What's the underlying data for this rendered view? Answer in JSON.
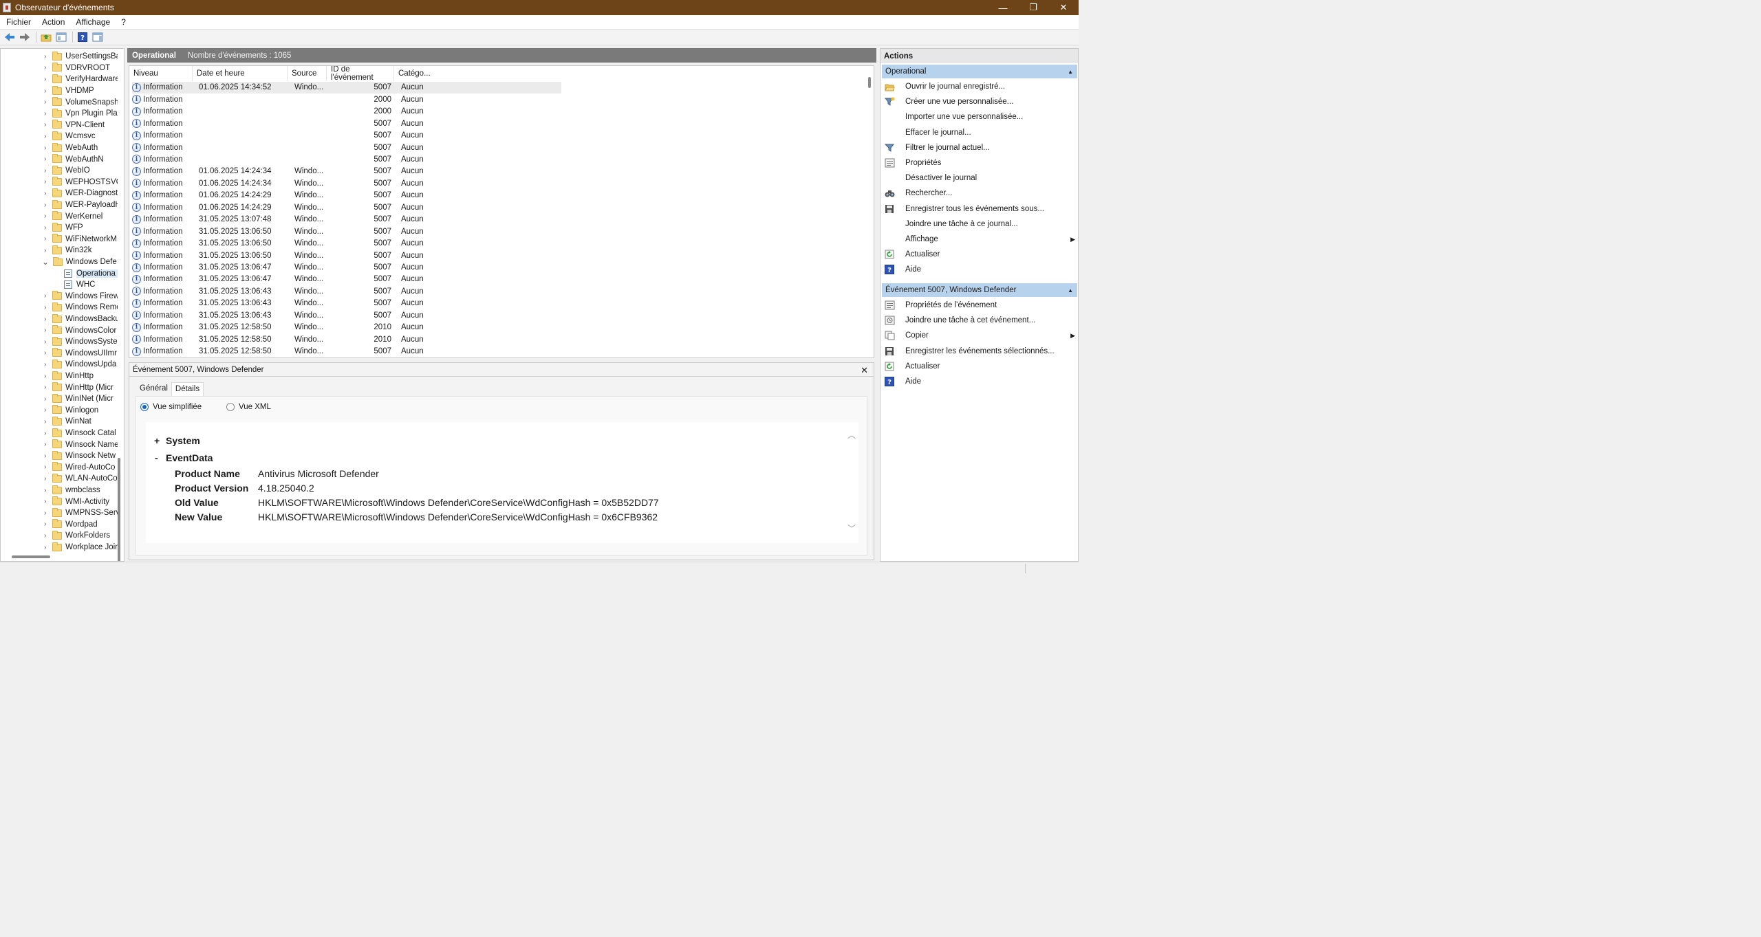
{
  "window": {
    "title": "Observateur d'événements",
    "minimize": "—",
    "maximize": "❐",
    "close": "✕"
  },
  "menu": [
    "Fichier",
    "Action",
    "Affichage",
    "?"
  ],
  "tree": {
    "items": [
      {
        "label": "UserSettingsBa",
        "type": "folder",
        "expanded": false
      },
      {
        "label": "VDRVROOT",
        "type": "folder",
        "expanded": false
      },
      {
        "label": "VerifyHardware",
        "type": "folder",
        "expanded": false
      },
      {
        "label": "VHDMP",
        "type": "folder",
        "expanded": false
      },
      {
        "label": "VolumeSnapsh",
        "type": "folder",
        "expanded": false
      },
      {
        "label": "Vpn Plugin Pla",
        "type": "folder",
        "expanded": false
      },
      {
        "label": "VPN-Client",
        "type": "folder",
        "expanded": false
      },
      {
        "label": "Wcmsvc",
        "type": "folder",
        "expanded": false
      },
      {
        "label": "WebAuth",
        "type": "folder",
        "expanded": false
      },
      {
        "label": "WebAuthN",
        "type": "folder",
        "expanded": false
      },
      {
        "label": "WebIO",
        "type": "folder",
        "expanded": false
      },
      {
        "label": "WEPHOSTSVC",
        "type": "folder",
        "expanded": false
      },
      {
        "label": "WER-Diagnost",
        "type": "folder",
        "expanded": false
      },
      {
        "label": "WER-PayloadH",
        "type": "folder",
        "expanded": false
      },
      {
        "label": "WerKernel",
        "type": "folder",
        "expanded": false
      },
      {
        "label": "WFP",
        "type": "folder",
        "expanded": false
      },
      {
        "label": "WiFiNetworkM",
        "type": "folder",
        "expanded": false
      },
      {
        "label": "Win32k",
        "type": "folder",
        "expanded": false
      },
      {
        "label": "Windows Defe",
        "type": "folder",
        "expanded": true
      },
      {
        "label": "Operationa",
        "type": "log",
        "selected": true
      },
      {
        "label": "WHC",
        "type": "log"
      },
      {
        "label": "Windows Firew",
        "type": "folder",
        "expanded": false
      },
      {
        "label": "Windows Remo",
        "type": "folder",
        "expanded": false
      },
      {
        "label": "WindowsBacku",
        "type": "folder",
        "expanded": false
      },
      {
        "label": "WindowsColor",
        "type": "folder",
        "expanded": false
      },
      {
        "label": "WindowsSyste",
        "type": "folder",
        "expanded": false
      },
      {
        "label": "WindowsUIImr",
        "type": "folder",
        "expanded": false
      },
      {
        "label": "WindowsUpda",
        "type": "folder",
        "expanded": false
      },
      {
        "label": "WinHttp",
        "type": "folder",
        "expanded": false
      },
      {
        "label": "WinHttp (Micr",
        "type": "folder",
        "expanded": false
      },
      {
        "label": "WinINet (Micr",
        "type": "folder",
        "expanded": false
      },
      {
        "label": "Winlogon",
        "type": "folder",
        "expanded": false
      },
      {
        "label": "WinNat",
        "type": "folder",
        "expanded": false
      },
      {
        "label": "Winsock Catal",
        "type": "folder",
        "expanded": false
      },
      {
        "label": "Winsock Name",
        "type": "folder",
        "expanded": false
      },
      {
        "label": "Winsock Netw",
        "type": "folder",
        "expanded": false
      },
      {
        "label": "Wired-AutoCo",
        "type": "folder",
        "expanded": false
      },
      {
        "label": "WLAN-AutoCo",
        "type": "folder",
        "expanded": false
      },
      {
        "label": "wmbclass",
        "type": "folder",
        "expanded": false
      },
      {
        "label": "WMI-Activity",
        "type": "folder",
        "expanded": false
      },
      {
        "label": "WMPNSS-Serv",
        "type": "folder",
        "expanded": false
      },
      {
        "label": "Wordpad",
        "type": "folder",
        "expanded": false
      },
      {
        "label": "WorkFolders",
        "type": "folder",
        "expanded": false
      },
      {
        "label": "Workplace Join",
        "type": "folder",
        "expanded": false
      }
    ]
  },
  "center": {
    "log_name": "Operational",
    "count_text": "Nombre d'événements : 1065"
  },
  "events": {
    "columns": [
      "Niveau",
      "Date et heure",
      "Source",
      "ID de l'événement",
      "Catégo..."
    ],
    "rows": [
      {
        "level": "Information",
        "date": "01.06.2025 14:34:52",
        "source": "Windo...",
        "id": "5007",
        "cat": "Aucun"
      },
      {
        "level": "Information",
        "date": "",
        "source": "",
        "id": "2000",
        "cat": "Aucun"
      },
      {
        "level": "Information",
        "date": "",
        "source": "",
        "id": "2000",
        "cat": "Aucun"
      },
      {
        "level": "Information",
        "date": "",
        "source": "",
        "id": "5007",
        "cat": "Aucun"
      },
      {
        "level": "Information",
        "date": "",
        "source": "",
        "id": "5007",
        "cat": "Aucun"
      },
      {
        "level": "Information",
        "date": "",
        "source": "",
        "id": "5007",
        "cat": "Aucun"
      },
      {
        "level": "Information",
        "date": "",
        "source": "",
        "id": "5007",
        "cat": "Aucun"
      },
      {
        "level": "Information",
        "date": "01.06.2025 14:24:34",
        "source": "Windo...",
        "id": "5007",
        "cat": "Aucun"
      },
      {
        "level": "Information",
        "date": "01.06.2025 14:24:34",
        "source": "Windo...",
        "id": "5007",
        "cat": "Aucun"
      },
      {
        "level": "Information",
        "date": "01.06.2025 14:24:29",
        "source": "Windo...",
        "id": "5007",
        "cat": "Aucun"
      },
      {
        "level": "Information",
        "date": "01.06.2025 14:24:29",
        "source": "Windo...",
        "id": "5007",
        "cat": "Aucun"
      },
      {
        "level": "Information",
        "date": "31.05.2025 13:07:48",
        "source": "Windo...",
        "id": "5007",
        "cat": "Aucun"
      },
      {
        "level": "Information",
        "date": "31.05.2025 13:06:50",
        "source": "Windo...",
        "id": "5007",
        "cat": "Aucun"
      },
      {
        "level": "Information",
        "date": "31.05.2025 13:06:50",
        "source": "Windo...",
        "id": "5007",
        "cat": "Aucun"
      },
      {
        "level": "Information",
        "date": "31.05.2025 13:06:50",
        "source": "Windo...",
        "id": "5007",
        "cat": "Aucun"
      },
      {
        "level": "Information",
        "date": "31.05.2025 13:06:47",
        "source": "Windo...",
        "id": "5007",
        "cat": "Aucun"
      },
      {
        "level": "Information",
        "date": "31.05.2025 13:06:47",
        "source": "Windo...",
        "id": "5007",
        "cat": "Aucun"
      },
      {
        "level": "Information",
        "date": "31.05.2025 13:06:43",
        "source": "Windo...",
        "id": "5007",
        "cat": "Aucun"
      },
      {
        "level": "Information",
        "date": "31.05.2025 13:06:43",
        "source": "Windo...",
        "id": "5007",
        "cat": "Aucun"
      },
      {
        "level": "Information",
        "date": "31.05.2025 13:06:43",
        "source": "Windo...",
        "id": "5007",
        "cat": "Aucun"
      },
      {
        "level": "Information",
        "date": "31.05.2025 12:58:50",
        "source": "Windo...",
        "id": "2010",
        "cat": "Aucun"
      },
      {
        "level": "Information",
        "date": "31.05.2025 12:58:50",
        "source": "Windo...",
        "id": "2010",
        "cat": "Aucun"
      },
      {
        "level": "Information",
        "date": "31.05.2025 12:58:50",
        "source": "Windo...",
        "id": "5007",
        "cat": "Aucun"
      }
    ]
  },
  "detail": {
    "title": "Événement 5007, Windows Defender",
    "tabs": [
      "Général",
      "Détails"
    ],
    "radio_simple": "Vue simplifiée",
    "radio_xml": "Vue XML",
    "system_label": "System",
    "system_toggle": "+",
    "eventdata_label": "EventData",
    "eventdata_toggle": "-",
    "fields": [
      {
        "key": "Product Name",
        "value": "Antivirus Microsoft Defender"
      },
      {
        "key": "Product Version",
        "value": "4.18.25040.2"
      },
      {
        "key": "Old Value",
        "value": "HKLM\\SOFTWARE\\Microsoft\\Windows Defender\\CoreService\\WdConfigHash = 0x5B52DD77"
      },
      {
        "key": "New Value",
        "value": "HKLM\\SOFTWARE\\Microsoft\\Windows Defender\\CoreService\\WdConfigHash = 0x6CFB9362"
      }
    ]
  },
  "actions": {
    "header": "Actions",
    "group1": "Operational",
    "group1_items": [
      {
        "label": "Ouvrir le journal enregistré...",
        "icon": "open-folder-icon"
      },
      {
        "label": "Créer une vue personnalisée...",
        "icon": "filter-create-icon"
      },
      {
        "label": "Importer une vue personnalisée...",
        "icon": ""
      },
      {
        "label": "Effacer le journal...",
        "icon": ""
      },
      {
        "label": "Filtrer le journal actuel...",
        "icon": "filter-icon"
      },
      {
        "label": "Propriétés",
        "icon": "properties-icon"
      },
      {
        "label": "Désactiver le journal",
        "icon": ""
      },
      {
        "label": "Rechercher...",
        "icon": "binoculars-icon"
      },
      {
        "label": "Enregistrer tous les événements sous...",
        "icon": "save-icon"
      },
      {
        "label": "Joindre une tâche à ce journal...",
        "icon": ""
      },
      {
        "label": "Affichage",
        "icon": "",
        "submenu": true
      },
      {
        "label": "Actualiser",
        "icon": "refresh-icon"
      },
      {
        "label": "Aide",
        "icon": "help-icon"
      }
    ],
    "group2": "Événement 5007, Windows Defender",
    "group2_items": [
      {
        "label": "Propriétés de l'événement",
        "icon": "properties-icon"
      },
      {
        "label": "Joindre une tâche à cet événement...",
        "icon": "task-icon"
      },
      {
        "label": "Copier",
        "icon": "copy-icon",
        "submenu": true
      },
      {
        "label": "Enregistrer les événements sélectionnés...",
        "icon": "save-icon"
      },
      {
        "label": "Actualiser",
        "icon": "refresh-icon"
      },
      {
        "label": "Aide",
        "icon": "help-icon"
      }
    ]
  },
  "colors": {
    "titlebar": "#6d4318",
    "group_bg": "#b7d2ec",
    "header_gray": "#7a7a7a",
    "info_blue": "#2a5699"
  }
}
